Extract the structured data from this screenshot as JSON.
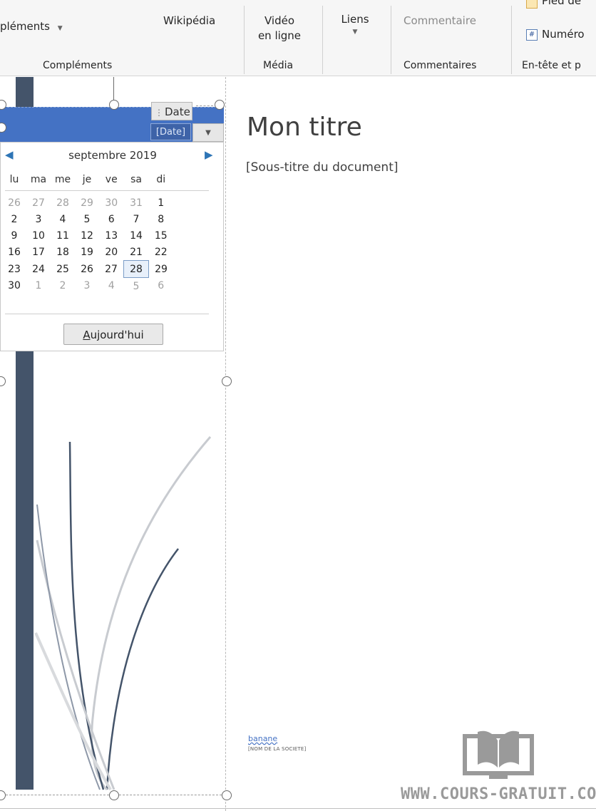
{
  "ribbon": {
    "complements_button": "pléments",
    "complements_group": "Compléments",
    "wikipedia": "Wikipédia",
    "video_line1": "Vidéo",
    "video_line2": "en ligne",
    "media_group": "Média",
    "links": "Liens",
    "comment": "Commentaire",
    "comments_group": "Commentaires",
    "footer_partial": "Pied de",
    "page_number_partial": "Numéro",
    "header_footer_group_partial": "En-tête et p"
  },
  "date_control": {
    "tag_label": "Date",
    "field_text": "[Date]"
  },
  "calendar": {
    "month_label": "septembre 2019",
    "weekdays": [
      "lu",
      "ma",
      "me",
      "je",
      "ve",
      "sa",
      "di"
    ],
    "weeks": [
      [
        {
          "d": "26",
          "other": true
        },
        {
          "d": "27",
          "other": true
        },
        {
          "d": "28",
          "other": true
        },
        {
          "d": "29",
          "other": true
        },
        {
          "d": "30",
          "other": true
        },
        {
          "d": "31",
          "other": true
        },
        {
          "d": "1"
        }
      ],
      [
        {
          "d": "2"
        },
        {
          "d": "3"
        },
        {
          "d": "4"
        },
        {
          "d": "5"
        },
        {
          "d": "6"
        },
        {
          "d": "7"
        },
        {
          "d": "8"
        }
      ],
      [
        {
          "d": "9"
        },
        {
          "d": "10"
        },
        {
          "d": "11"
        },
        {
          "d": "12"
        },
        {
          "d": "13"
        },
        {
          "d": "14"
        },
        {
          "d": "15"
        }
      ],
      [
        {
          "d": "16"
        },
        {
          "d": "17"
        },
        {
          "d": "18"
        },
        {
          "d": "19"
        },
        {
          "d": "20"
        },
        {
          "d": "21"
        },
        {
          "d": "22"
        }
      ],
      [
        {
          "d": "23"
        },
        {
          "d": "24"
        },
        {
          "d": "25"
        },
        {
          "d": "26"
        },
        {
          "d": "27"
        },
        {
          "d": "28",
          "selected": true
        },
        {
          "d": "29"
        }
      ],
      [
        {
          "d": "30"
        },
        {
          "d": "1",
          "other": true
        },
        {
          "d": "2",
          "other": true
        },
        {
          "d": "3",
          "other": true
        },
        {
          "d": "4",
          "other": true
        },
        {
          "d": "5",
          "other": true
        },
        {
          "d": "6",
          "other": true
        }
      ]
    ],
    "today_button_accel": "A",
    "today_button_rest": "ujourd'hui"
  },
  "document": {
    "title": "Mon titre",
    "subtitle": "[Sous-titre du document]",
    "author": "banane",
    "company": "[NOM DE LA SOCIETE]"
  },
  "watermark": {
    "text": "WWW.COURS-GRATUIT.COM"
  },
  "colors": {
    "accent_blue": "#4472c4",
    "dark_bar": "#44546a"
  }
}
